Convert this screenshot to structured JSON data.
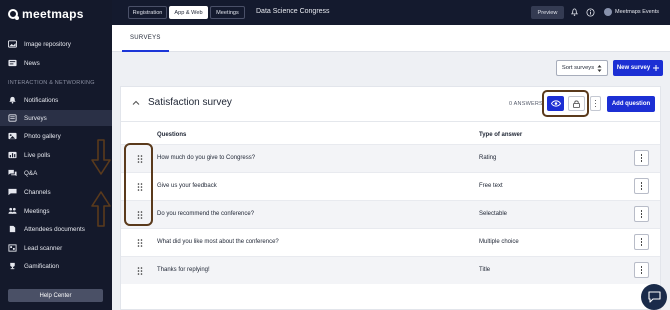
{
  "brand": {
    "name": "meetmaps"
  },
  "sidebar": {
    "items_top": [
      {
        "label": "Image repository",
        "icon": "image-icon"
      },
      {
        "label": "News",
        "icon": "news-icon"
      }
    ],
    "section_label": "INTERACTION & NETWORKING",
    "items": [
      {
        "label": "Notifications",
        "icon": "bell-icon"
      },
      {
        "label": "Surveys",
        "icon": "survey-icon",
        "active": true
      },
      {
        "label": "Photo gallery",
        "icon": "photo-icon"
      },
      {
        "label": "Live polls",
        "icon": "poll-icon"
      },
      {
        "label": "Q&A",
        "icon": "qa-icon"
      },
      {
        "label": "Channels",
        "icon": "channels-icon"
      },
      {
        "label": "Meetings",
        "icon": "meetings-icon"
      },
      {
        "label": "Attendees documents",
        "icon": "document-icon"
      },
      {
        "label": "Lead scanner",
        "icon": "scanner-icon"
      },
      {
        "label": "Gamification",
        "icon": "trophy-icon"
      }
    ],
    "help_label": "Help Center"
  },
  "topbar": {
    "tabs": [
      {
        "label": "Registration"
      },
      {
        "label": "App & Web",
        "active": true
      },
      {
        "label": "Meetings"
      }
    ],
    "event_title": "Data Science Congress",
    "preview_label": "Preview",
    "user_name": "Meetmaps Events"
  },
  "subtabs": {
    "active": "SURVEYS"
  },
  "actions": {
    "sort_label": "Sort surveys",
    "new_label": "New survey"
  },
  "survey": {
    "title": "Satisfaction survey",
    "answers": "0 ANSWERS",
    "add_label": "Add question",
    "col_question": "Questions",
    "col_type": "Type of answer",
    "questions": [
      {
        "text": "How much do you give to Congress?",
        "type": "Rating"
      },
      {
        "text": "Give us your feedback",
        "type": "Free text"
      },
      {
        "text": "Do you recommend the conference?",
        "type": "Selectable"
      },
      {
        "text": "What did you like most about the conference?",
        "type": "Multiple choice"
      },
      {
        "text": "Thanks for replying!",
        "type": "Title"
      }
    ]
  },
  "colors": {
    "accent": "#1c2fd4",
    "sidebar_bg": "#14192b",
    "annotation": "#5a3a1c"
  }
}
